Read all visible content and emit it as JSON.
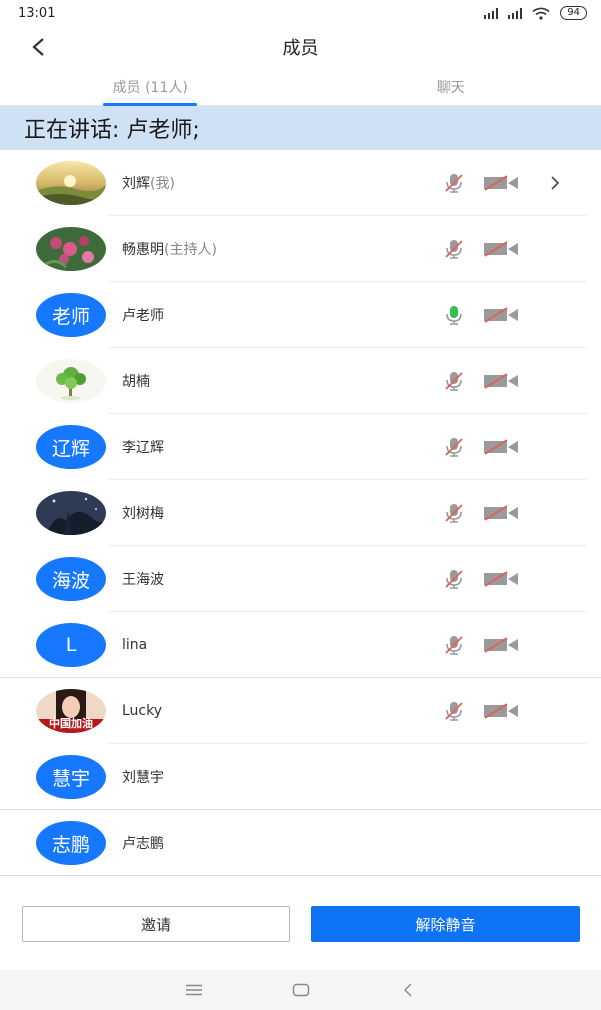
{
  "status": {
    "time": "13:01",
    "battery": "94"
  },
  "header": {
    "title": "成员"
  },
  "tabs": [
    {
      "label": "成员 (11人)",
      "active": true
    },
    {
      "label": "聊天",
      "active": false
    }
  ],
  "speaking": {
    "text": "正在讲话: 卢老师;"
  },
  "members": [
    {
      "name": "刘辉",
      "suffix": "(我)",
      "avatar_type": "image",
      "avatar_icon": "landscape-photo-avatar",
      "mic": "muted",
      "camera": "off",
      "chevron": true
    },
    {
      "name": "畅惠明",
      "suffix": "(主持人)",
      "avatar_type": "image",
      "avatar_icon": "flower-photo-avatar",
      "mic": "muted",
      "camera": "off"
    },
    {
      "name": "卢老师",
      "avatar_type": "text",
      "avatar_text": "老师",
      "mic": "active",
      "camera": "off"
    },
    {
      "name": "胡楠",
      "avatar_type": "image",
      "avatar_icon": "tree-photo-avatar",
      "mic": "muted",
      "camera": "off"
    },
    {
      "name": "李辽辉",
      "avatar_type": "text",
      "avatar_text": "辽辉",
      "mic": "muted",
      "camera": "off"
    },
    {
      "name": "刘树梅",
      "avatar_type": "image",
      "avatar_icon": "night-sky-photo-avatar",
      "mic": "muted",
      "camera": "off"
    },
    {
      "name": "王海波",
      "avatar_type": "text",
      "avatar_text": "海波",
      "mic": "muted",
      "camera": "off"
    },
    {
      "name": "lina",
      "avatar_type": "text",
      "avatar_text": "L",
      "mic": "muted",
      "camera": "off"
    },
    {
      "name": "Lucky",
      "avatar_type": "image",
      "avatar_icon": "girl-photo-avatar",
      "avatar_caption": "中国加油",
      "mic": "muted",
      "camera": "off"
    },
    {
      "name": "刘慧宇",
      "avatar_type": "text",
      "avatar_text": "慧宇"
    },
    {
      "name": "卢志鹏",
      "avatar_type": "text",
      "avatar_text": "志鹏"
    }
  ],
  "actions": {
    "invite": "邀请",
    "unmute_all": "解除静音"
  },
  "colors": {
    "accent": "#1677ff",
    "speaking_bg": "#cfe1f5",
    "muted_red": "#e0605a",
    "mic_active": "#35c04a"
  }
}
